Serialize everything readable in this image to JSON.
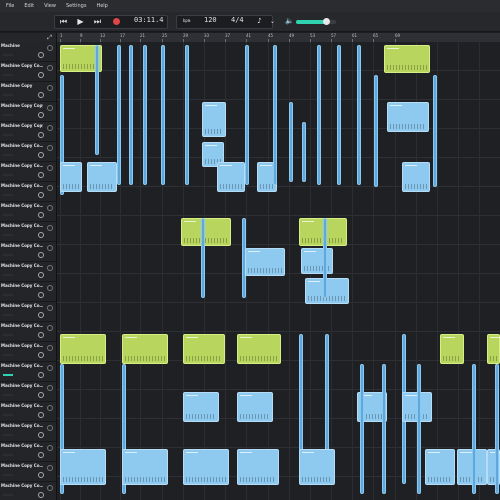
{
  "menu": {
    "items": [
      "File",
      "Edit",
      "View",
      "Settings",
      "Help"
    ]
  },
  "transport": {
    "time": "03:11.4",
    "bpm": "120",
    "bpm_unit": "bpm",
    "signature": "4/4",
    "volume_level": 0.75
  },
  "ruler": {
    "ticks": [
      "1",
      "9",
      "13",
      "17",
      "21",
      "25",
      "29",
      "33",
      "37",
      "41",
      "45",
      "49",
      "53",
      "57",
      "61",
      "65",
      "69"
    ]
  },
  "tracks": [
    {
      "name": "Machine"
    },
    {
      "name": "Machine Copy Co…"
    },
    {
      "name": "Machine Copy"
    },
    {
      "name": "Machine Copy Copy"
    },
    {
      "name": "Machine Copy Copy"
    },
    {
      "name": "Machine Copy Co…"
    },
    {
      "name": "Machine Copy Co…"
    },
    {
      "name": "Machine Copy Co…"
    },
    {
      "name": "Machine Copy Co…"
    },
    {
      "name": "Machine Copy Co…"
    },
    {
      "name": "Machine Copy Co…"
    },
    {
      "name": "Machine Copy Co…"
    },
    {
      "name": "Machine Copy Co…"
    },
    {
      "name": "Machine Copy Co…"
    },
    {
      "name": "Machine Copy Co…"
    },
    {
      "name": "Machine Copy Co…"
    },
    {
      "name": "Machine Copy Co…"
    },
    {
      "name": "Machine Copy Co…"
    },
    {
      "name": "Machine Copy Co…"
    },
    {
      "name": "Machine Copy Co…"
    },
    {
      "name": "Machine Copy Co…"
    },
    {
      "name": "Machine Copy Co…"
    },
    {
      "name": "Machine Copy Co…"
    }
  ]
}
